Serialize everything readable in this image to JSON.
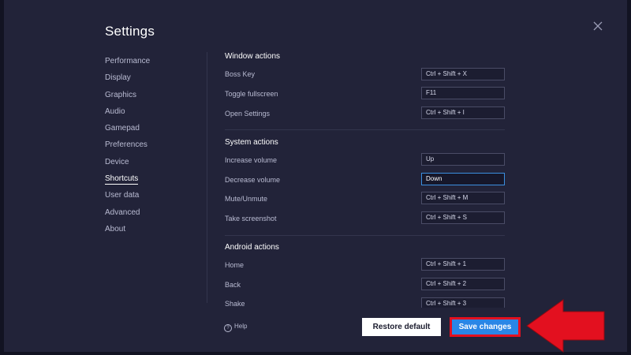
{
  "window": {
    "title": "Settings"
  },
  "sidebar": {
    "items": [
      {
        "label": "Performance",
        "active": false
      },
      {
        "label": "Display",
        "active": false
      },
      {
        "label": "Graphics",
        "active": false
      },
      {
        "label": "Audio",
        "active": false
      },
      {
        "label": "Gamepad",
        "active": false
      },
      {
        "label": "Preferences",
        "active": false
      },
      {
        "label": "Device",
        "active": false
      },
      {
        "label": "Shortcuts",
        "active": true
      },
      {
        "label": "User data",
        "active": false
      },
      {
        "label": "Advanced",
        "active": false
      },
      {
        "label": "About",
        "active": false
      }
    ]
  },
  "sections": {
    "window_actions": {
      "title": "Window actions",
      "rows": [
        {
          "label": "Boss Key",
          "value": "Ctrl + Shift + X"
        },
        {
          "label": "Toggle fullscreen",
          "value": "F11"
        },
        {
          "label": "Open Settings",
          "value": "Ctrl + Shift + I"
        }
      ]
    },
    "system_actions": {
      "title": "System actions",
      "rows": [
        {
          "label": "Increase volume",
          "value": "Up"
        },
        {
          "label": "Decrease volume",
          "value": "Down"
        },
        {
          "label": "Mute/Unmute",
          "value": "Ctrl + Shift + M"
        },
        {
          "label": "Take screenshot",
          "value": "Ctrl + Shift + S"
        }
      ]
    },
    "android_actions": {
      "title": "Android actions",
      "rows": [
        {
          "label": "Home",
          "value": "Ctrl + Shift + 1"
        },
        {
          "label": "Back",
          "value": "Ctrl + Shift + 2"
        },
        {
          "label": "Shake",
          "value": "Ctrl + Shift + 3"
        }
      ]
    }
  },
  "footer": {
    "help_label": "Help",
    "restore_label": "Restore default",
    "save_label": "Save changes"
  },
  "icons": {
    "close": "close-icon",
    "help": "question-circle-icon",
    "annotation": "red-arrow-pointer"
  },
  "colors": {
    "background": "#222339",
    "accent": "#2a86e6",
    "annotation_red": "#e3101f",
    "focus_border": "#3b8fe0"
  }
}
